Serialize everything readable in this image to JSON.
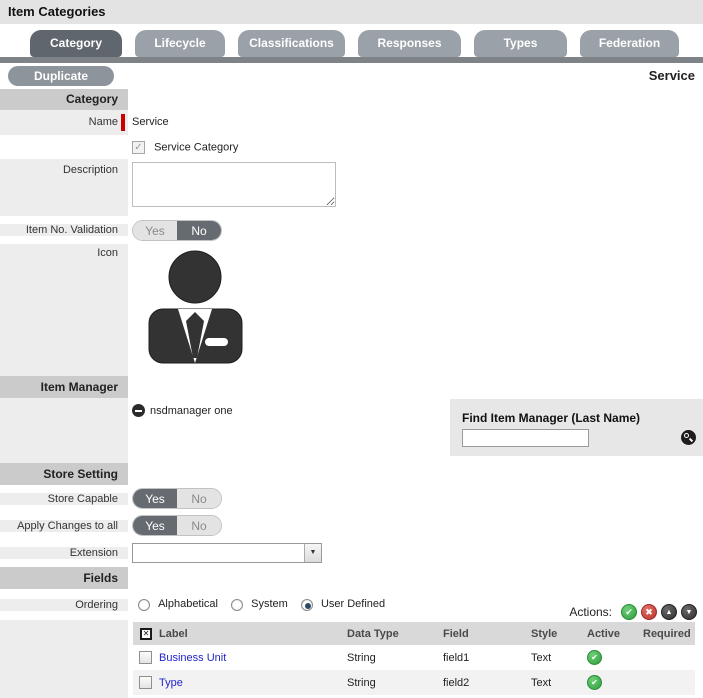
{
  "page": {
    "title": "Item Categories"
  },
  "tabs": [
    {
      "label": "Category",
      "active": true
    },
    {
      "label": "Lifecycle",
      "active": false
    },
    {
      "label": "Classifications",
      "active": false
    },
    {
      "label": "Responses",
      "active": false
    },
    {
      "label": "Types",
      "active": false
    },
    {
      "label": "Federation",
      "active": false
    }
  ],
  "toolbar": {
    "duplicate_label": "Duplicate",
    "context_name": "Service"
  },
  "toggle": {
    "yes": "Yes",
    "no": "No"
  },
  "category": {
    "section_label": "Category",
    "name_label": "Name",
    "name_value": "Service",
    "service_category_label": "Service Category",
    "service_category_checked": true,
    "description_label": "Description",
    "description_value": "",
    "item_no_validation_label": "Item No. Validation",
    "item_no_validation_value": "No",
    "icon_label": "Icon"
  },
  "item_manager": {
    "section_label": "Item Manager",
    "managers": [
      {
        "name": "nsdmanager one"
      }
    ],
    "find_label": "Find Item Manager (Last Name)",
    "find_value": ""
  },
  "store_setting": {
    "section_label": "Store Setting",
    "store_capable_label": "Store Capable",
    "store_capable_value": "Yes",
    "apply_changes_label": "Apply Changes to all",
    "apply_changes_value": "Yes",
    "extension_label": "Extension",
    "extension_value": ""
  },
  "fields": {
    "section_label": "Fields",
    "ordering_label": "Ordering",
    "ordering_options": [
      "Alphabetical",
      "System",
      "User Defined"
    ],
    "ordering_selected": "User Defined",
    "actions_label": "Actions:",
    "table": {
      "headers": [
        "Label",
        "Data Type",
        "Field",
        "Style",
        "Active",
        "Required"
      ],
      "rows": [
        {
          "label": "Business Unit",
          "data_type": "String",
          "field": "field1",
          "style": "Text",
          "active": true,
          "required": false
        },
        {
          "label": "Type",
          "data_type": "String",
          "field": "field2",
          "style": "Text",
          "active": true,
          "required": false
        }
      ]
    }
  },
  "icons": {
    "check": "✔",
    "cross": "✖",
    "up": "▲",
    "down": "▼",
    "dropdown": "▼",
    "select_all": "✕"
  },
  "colors": {
    "accent_dark": "#5f666d",
    "tab_gray": "#9ba1a8",
    "section_header": "#cbcbcb",
    "label_col": "#ededed",
    "toggle_on": "#666b72",
    "link": "#2323cc",
    "success": "#2f9e3d",
    "danger": "#b8322b",
    "required_red": "#cc0000"
  }
}
